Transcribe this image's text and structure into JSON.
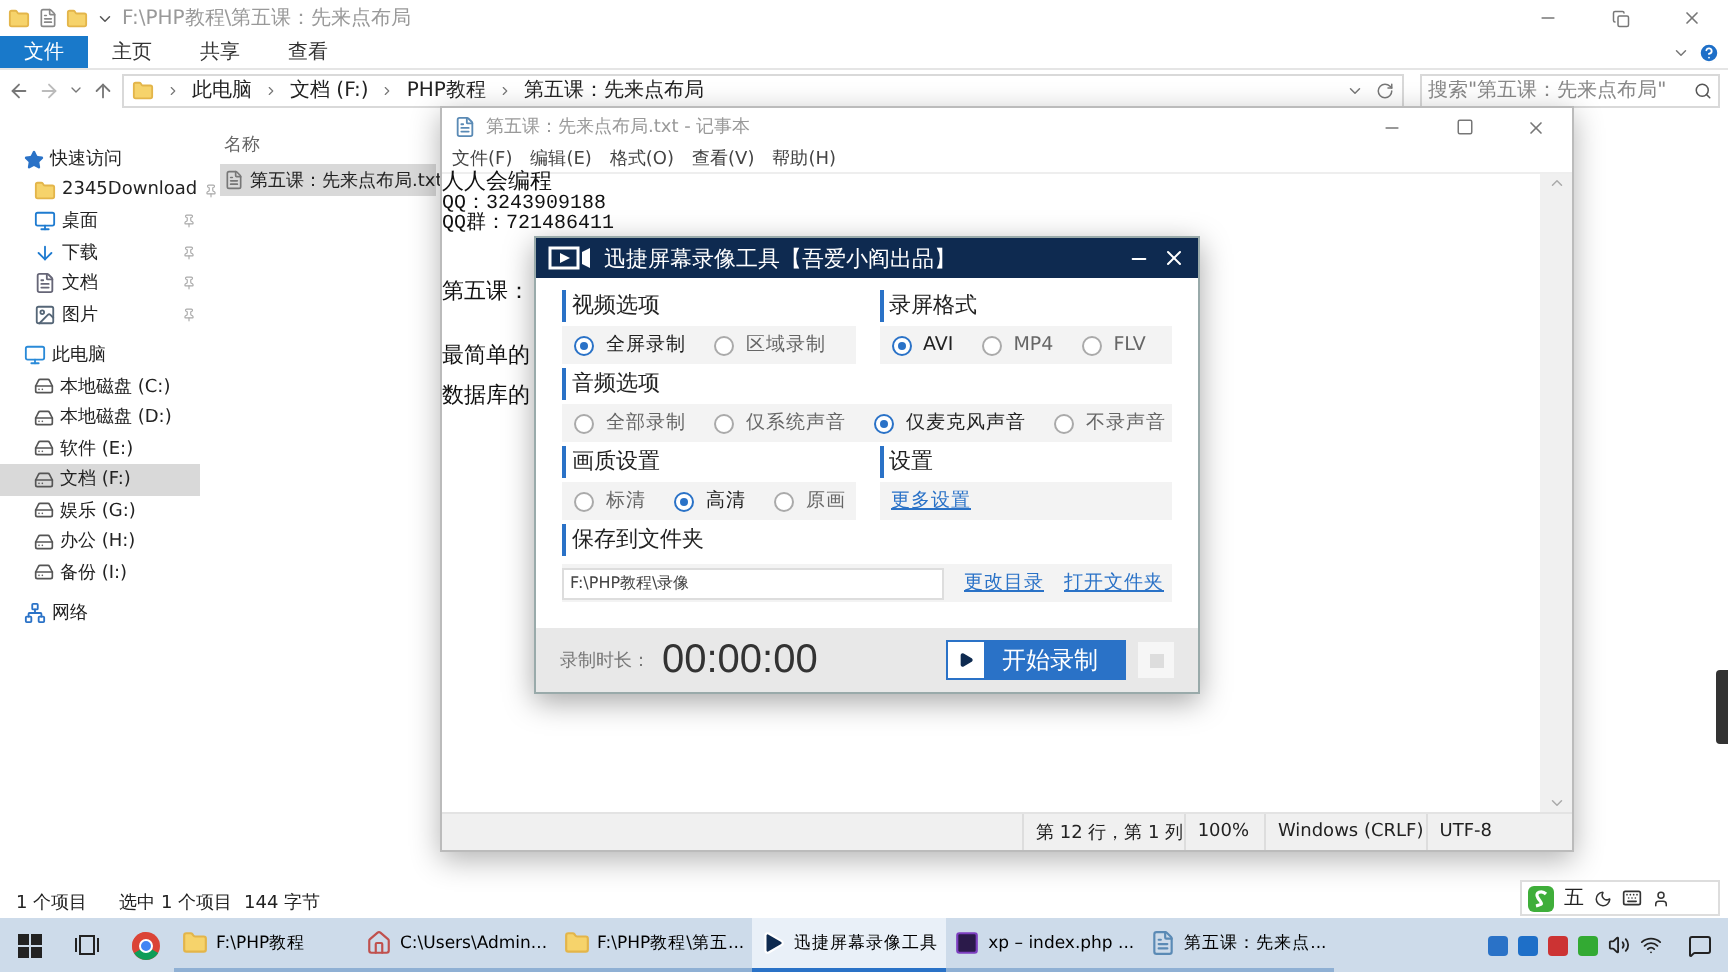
{
  "explorer": {
    "title": "F:\\PHP教程\\第五课：先来点布局",
    "ribbon_tabs": [
      {
        "label": "文件",
        "kind": "file",
        "selected": false
      },
      {
        "label": "主页",
        "kind": "tab",
        "selected": false
      },
      {
        "label": "共享",
        "kind": "tab",
        "selected": false
      },
      {
        "label": "查看",
        "kind": "tab",
        "selected": false
      }
    ],
    "breadcrumbs": [
      "此电脑",
      "文档 (F:)",
      "PHP教程",
      "第五课：先来点布局"
    ],
    "search": {
      "placeholder": "搜索\"第五课：先来点布局\""
    },
    "sidebar": [
      {
        "label": "快速访问",
        "kind": "star",
        "selected": false,
        "children": [
          {
            "label": "2345Download",
            "kind": "folder",
            "pinned": true,
            "selected": false
          },
          {
            "label": "桌面",
            "kind": "desktop",
            "pinned": true,
            "selected": false
          },
          {
            "label": "下载",
            "kind": "download",
            "pinned": true,
            "selected": false
          },
          {
            "label": "文档",
            "kind": "document",
            "pinned": true,
            "selected": false
          },
          {
            "label": "图片",
            "kind": "picture",
            "pinned": true,
            "selected": false
          }
        ]
      },
      {
        "label": "此电脑",
        "kind": "pc",
        "selected": false,
        "children": [
          {
            "label": "本地磁盘 (C:)",
            "kind": "drive",
            "selected": false
          },
          {
            "label": "本地磁盘 (D:)",
            "kind": "drive",
            "selected": false
          },
          {
            "label": "软件 (E:)",
            "kind": "drive",
            "selected": false
          },
          {
            "label": "文档 (F:)",
            "kind": "drive",
            "selected": true
          },
          {
            "label": "娱乐 (G:)",
            "kind": "drive",
            "selected": false
          },
          {
            "label": "办公 (H:)",
            "kind": "drive",
            "selected": false
          },
          {
            "label": "备份 (I:)",
            "kind": "drive",
            "selected": false
          }
        ]
      },
      {
        "label": "网络",
        "kind": "network",
        "selected": false
      }
    ],
    "columns": [
      "名称"
    ],
    "files": [
      {
        "name": "第五课：先来点布局.txt",
        "selected": true
      }
    ],
    "status": {
      "count": "1 个项目",
      "selection": "选中 1 个项目",
      "size": "144 字节"
    }
  },
  "notepad": {
    "title": "第五课：先来点布局.txt - 记事本",
    "menu": [
      "文件(F)",
      "编辑(E)",
      "格式(O)",
      "查看(V)",
      "帮助(H)"
    ],
    "paragraphs": [
      [
        "人人会编程",
        "QQ：3243909188",
        "QQ群：721486411"
      ],
      [
        "第五课："
      ],
      [
        "最简单的",
        "数据库的"
      ]
    ],
    "status": [
      "第 12 行，第 1 列",
      "100%",
      "Windows (CRLF)",
      "UTF-8"
    ]
  },
  "recorder": {
    "title": "迅捷屏幕录像工具【吾爱小阎出品】",
    "video": {
      "label": "视频选项",
      "options": [
        {
          "label": "全屏录制",
          "selected": true
        },
        {
          "label": "区域录制",
          "selected": false
        }
      ]
    },
    "format": {
      "label": "录屏格式",
      "options": [
        {
          "label": "AVI",
          "selected": true
        },
        {
          "label": "MP4",
          "selected": false
        },
        {
          "label": "FLV",
          "selected": false
        }
      ]
    },
    "audio": {
      "label": "音频选项",
      "options": [
        {
          "label": "全部录制",
          "selected": false
        },
        {
          "label": "仅系统声音",
          "selected": false
        },
        {
          "label": "仅麦克风声音",
          "selected": true
        },
        {
          "label": "不录声音",
          "selected": false
        }
      ]
    },
    "quality": {
      "label": "画质设置",
      "options": [
        {
          "label": "标清",
          "selected": false
        },
        {
          "label": "高清",
          "selected": true
        },
        {
          "label": "原画",
          "selected": false
        }
      ]
    },
    "settings": {
      "label": "设置",
      "link": "更多设置"
    },
    "save": {
      "label": "保存到文件夹",
      "value": "F:\\PHP教程\\录像",
      "links": [
        "更改目录",
        "打开文件夹"
      ]
    },
    "footer": {
      "label": "录制时长：",
      "time": "00:00:00",
      "start": "开始录制",
      "stop_disabled": true
    }
  },
  "ime": {
    "mode": "五"
  },
  "taskbar": [
    {
      "label": "F:\\PHP教程",
      "kind": "folder",
      "selected": false
    },
    {
      "label": "C:\\Users\\Admin...",
      "kind": "home",
      "selected": false
    },
    {
      "label": "F:\\PHP教程\\第五...",
      "kind": "folder",
      "selected": false
    },
    {
      "label": "迅捷屏幕录像工具",
      "kind": "recorder",
      "selected": true
    },
    {
      "label": "xp – index.php ...",
      "kind": "ide",
      "selected": false
    },
    {
      "label": "第五课：先来点...",
      "kind": "notepad",
      "selected": false
    }
  ]
}
